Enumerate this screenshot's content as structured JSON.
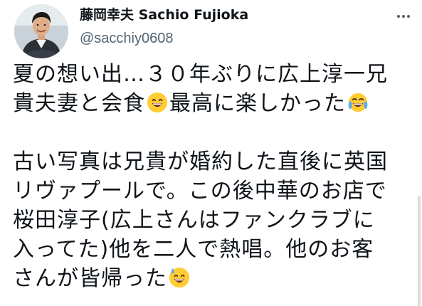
{
  "author": {
    "display_name": "藤岡幸夫 Sachio Fujioka",
    "handle": "@sacchiy0608"
  },
  "tweet": {
    "lines": [
      "夏の想い出…３０年ぶりに広上淳一兄",
      "貴夫妻と会食",
      "最高に楽しかった",
      "古い写真は兄貴が婚約した直後に英国",
      "リヴァプールで。この後中華のお店で",
      "桜田淳子(広上さんはファンクラブに",
      "入ってた)他を二人で熱唱。他のお客",
      "さんが皆帰った"
    ],
    "emojis": [
      "grinning-face-emoji",
      "face-with-tears-of-joy-emoji",
      "grinning-face-with-sweat-emoji"
    ]
  },
  "colors": {
    "text": "#0f1419",
    "secondary": "#536471",
    "emoji_yellow": "#ffcc33",
    "tear_blue": "#5dadec"
  },
  "icons": [
    "more-options-icon"
  ]
}
